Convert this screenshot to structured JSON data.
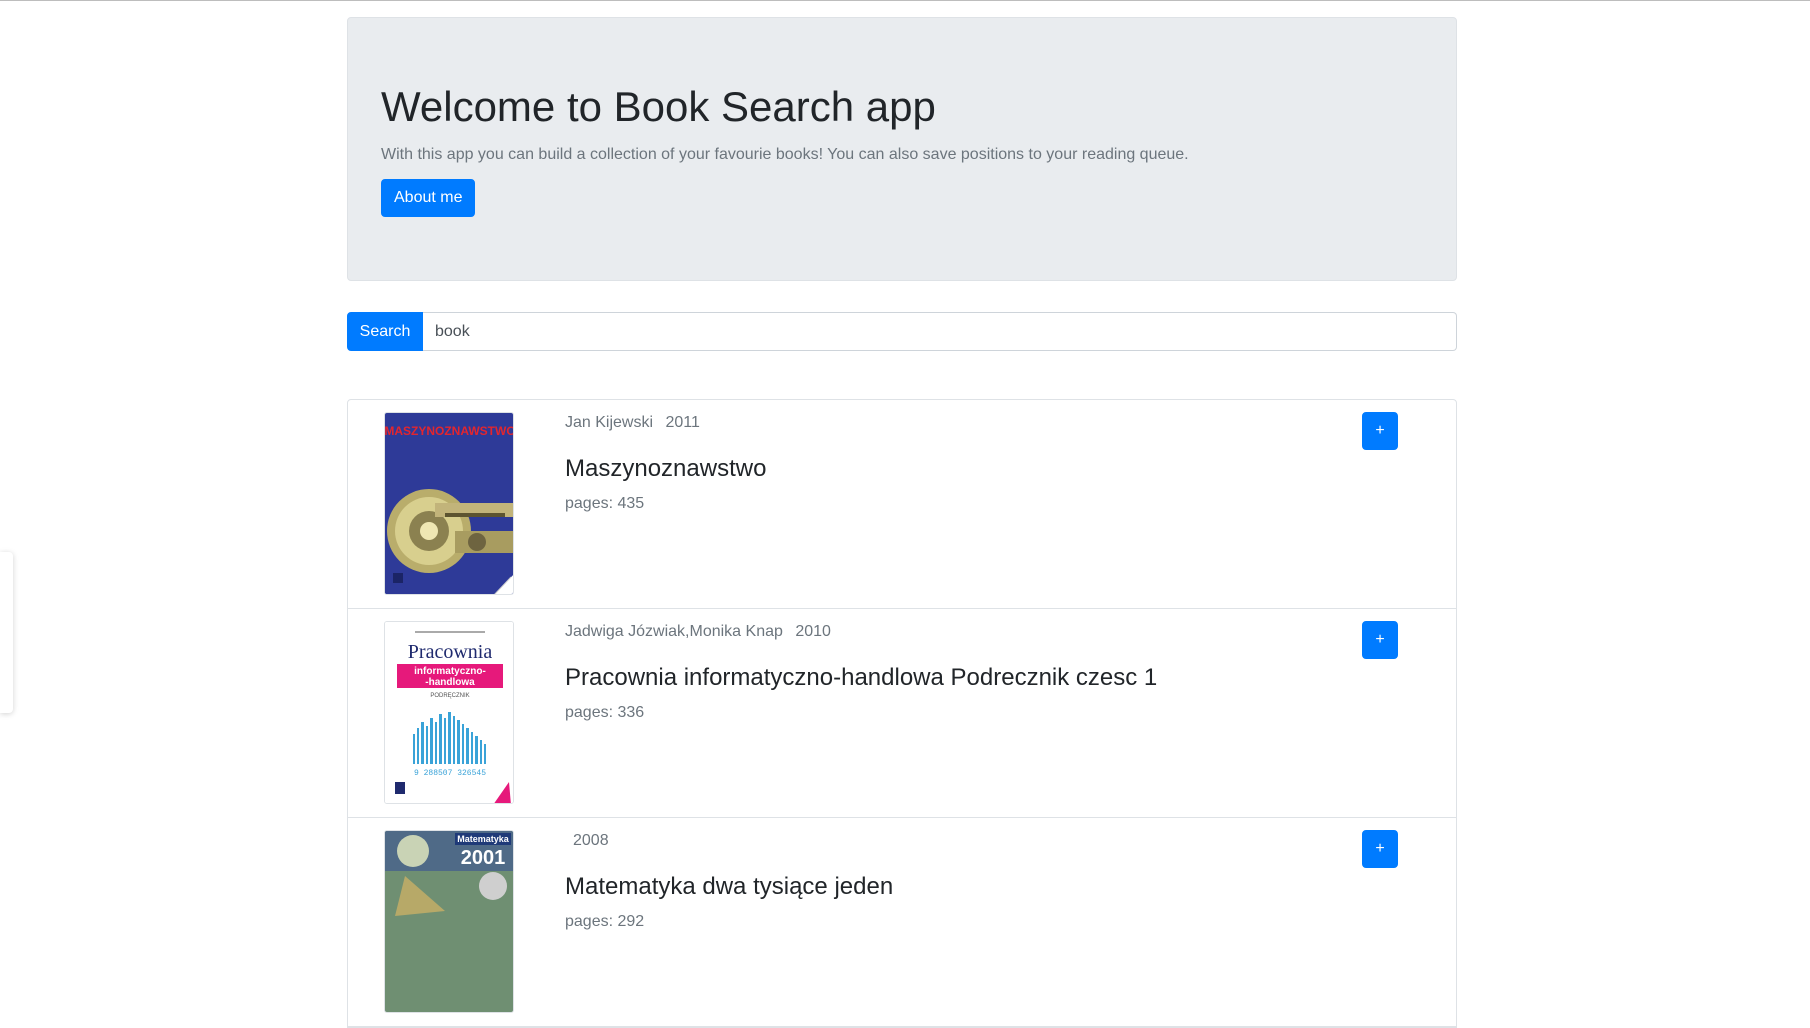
{
  "jumbotron": {
    "title": "Welcome to Book Search app",
    "lead": "With this app you can build a collection of your favourie books! You can also save positions to your reading queue.",
    "about_label": "About me"
  },
  "search": {
    "button_label": "Search",
    "value": "book"
  },
  "books": [
    {
      "author": "Jan Kijewski",
      "year": "2011",
      "title": "Maszynoznawstwo",
      "pages": "pages: 435",
      "add_label": "+",
      "cover": {
        "heading": "MASZYNOZNAWSTWO"
      }
    },
    {
      "author": "Jadwiga Józwiak,Monika Knap",
      "year": "2010",
      "title": "Pracownia informatyczno-handlowa Podrecznik czesc 1",
      "pages": "pages: 336",
      "add_label": "+",
      "cover": {
        "heading": "Pracownia",
        "band_line1": "informatyczno-",
        "band_line2": "-handlowa",
        "subtitle": "PODRĘCZNIK",
        "barcode": "9 288507 326545"
      }
    },
    {
      "author": "",
      "year": "2008",
      "title": "Matematyka dwa tysiące jeden",
      "pages": "pages: 292",
      "add_label": "+",
      "cover": {
        "heading": "Matematyka",
        "number": "2001"
      }
    }
  ],
  "colors": {
    "primary": "#007bff",
    "jumbotron_bg": "#e9ecef"
  }
}
